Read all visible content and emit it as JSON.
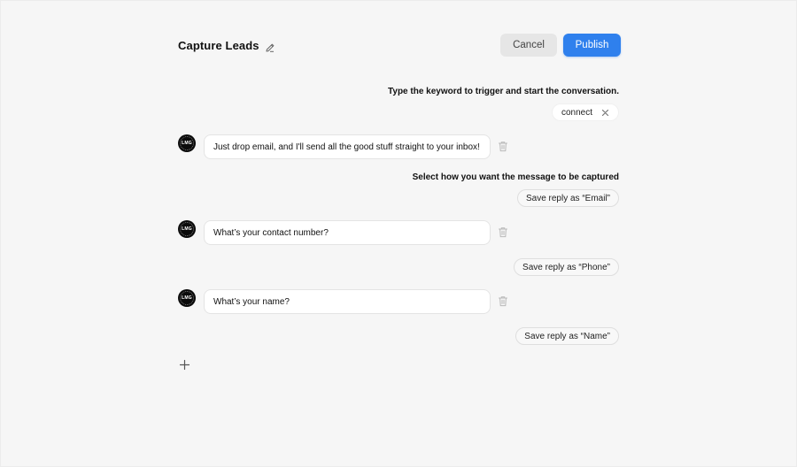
{
  "header": {
    "title": "Capture Leads",
    "cancel_label": "Cancel",
    "publish_label": "Publish"
  },
  "trigger": {
    "instruction": "Type the keyword to trigger and start the conversation.",
    "keyword": "connect"
  },
  "avatar": {
    "text": "LMG"
  },
  "messages": [
    {
      "text": "Just drop email, and I'll send all the good stuff straight to your inbox!",
      "capture_instruction": "Select how you want the message to be captured",
      "save_label": "Save reply as “Email”"
    },
    {
      "text": "What’s your contact number?",
      "save_label": "Save reply as “Phone”"
    },
    {
      "text": "What’s your name?",
      "save_label": "Save reply as “Name”"
    }
  ],
  "colors": {
    "background": "#f6f6f6",
    "primary": "#2f80ed",
    "cancel_bg": "#e6e6e6"
  },
  "icons": [
    "pencil-icon",
    "close-icon",
    "trash-icon",
    "plus-icon"
  ]
}
